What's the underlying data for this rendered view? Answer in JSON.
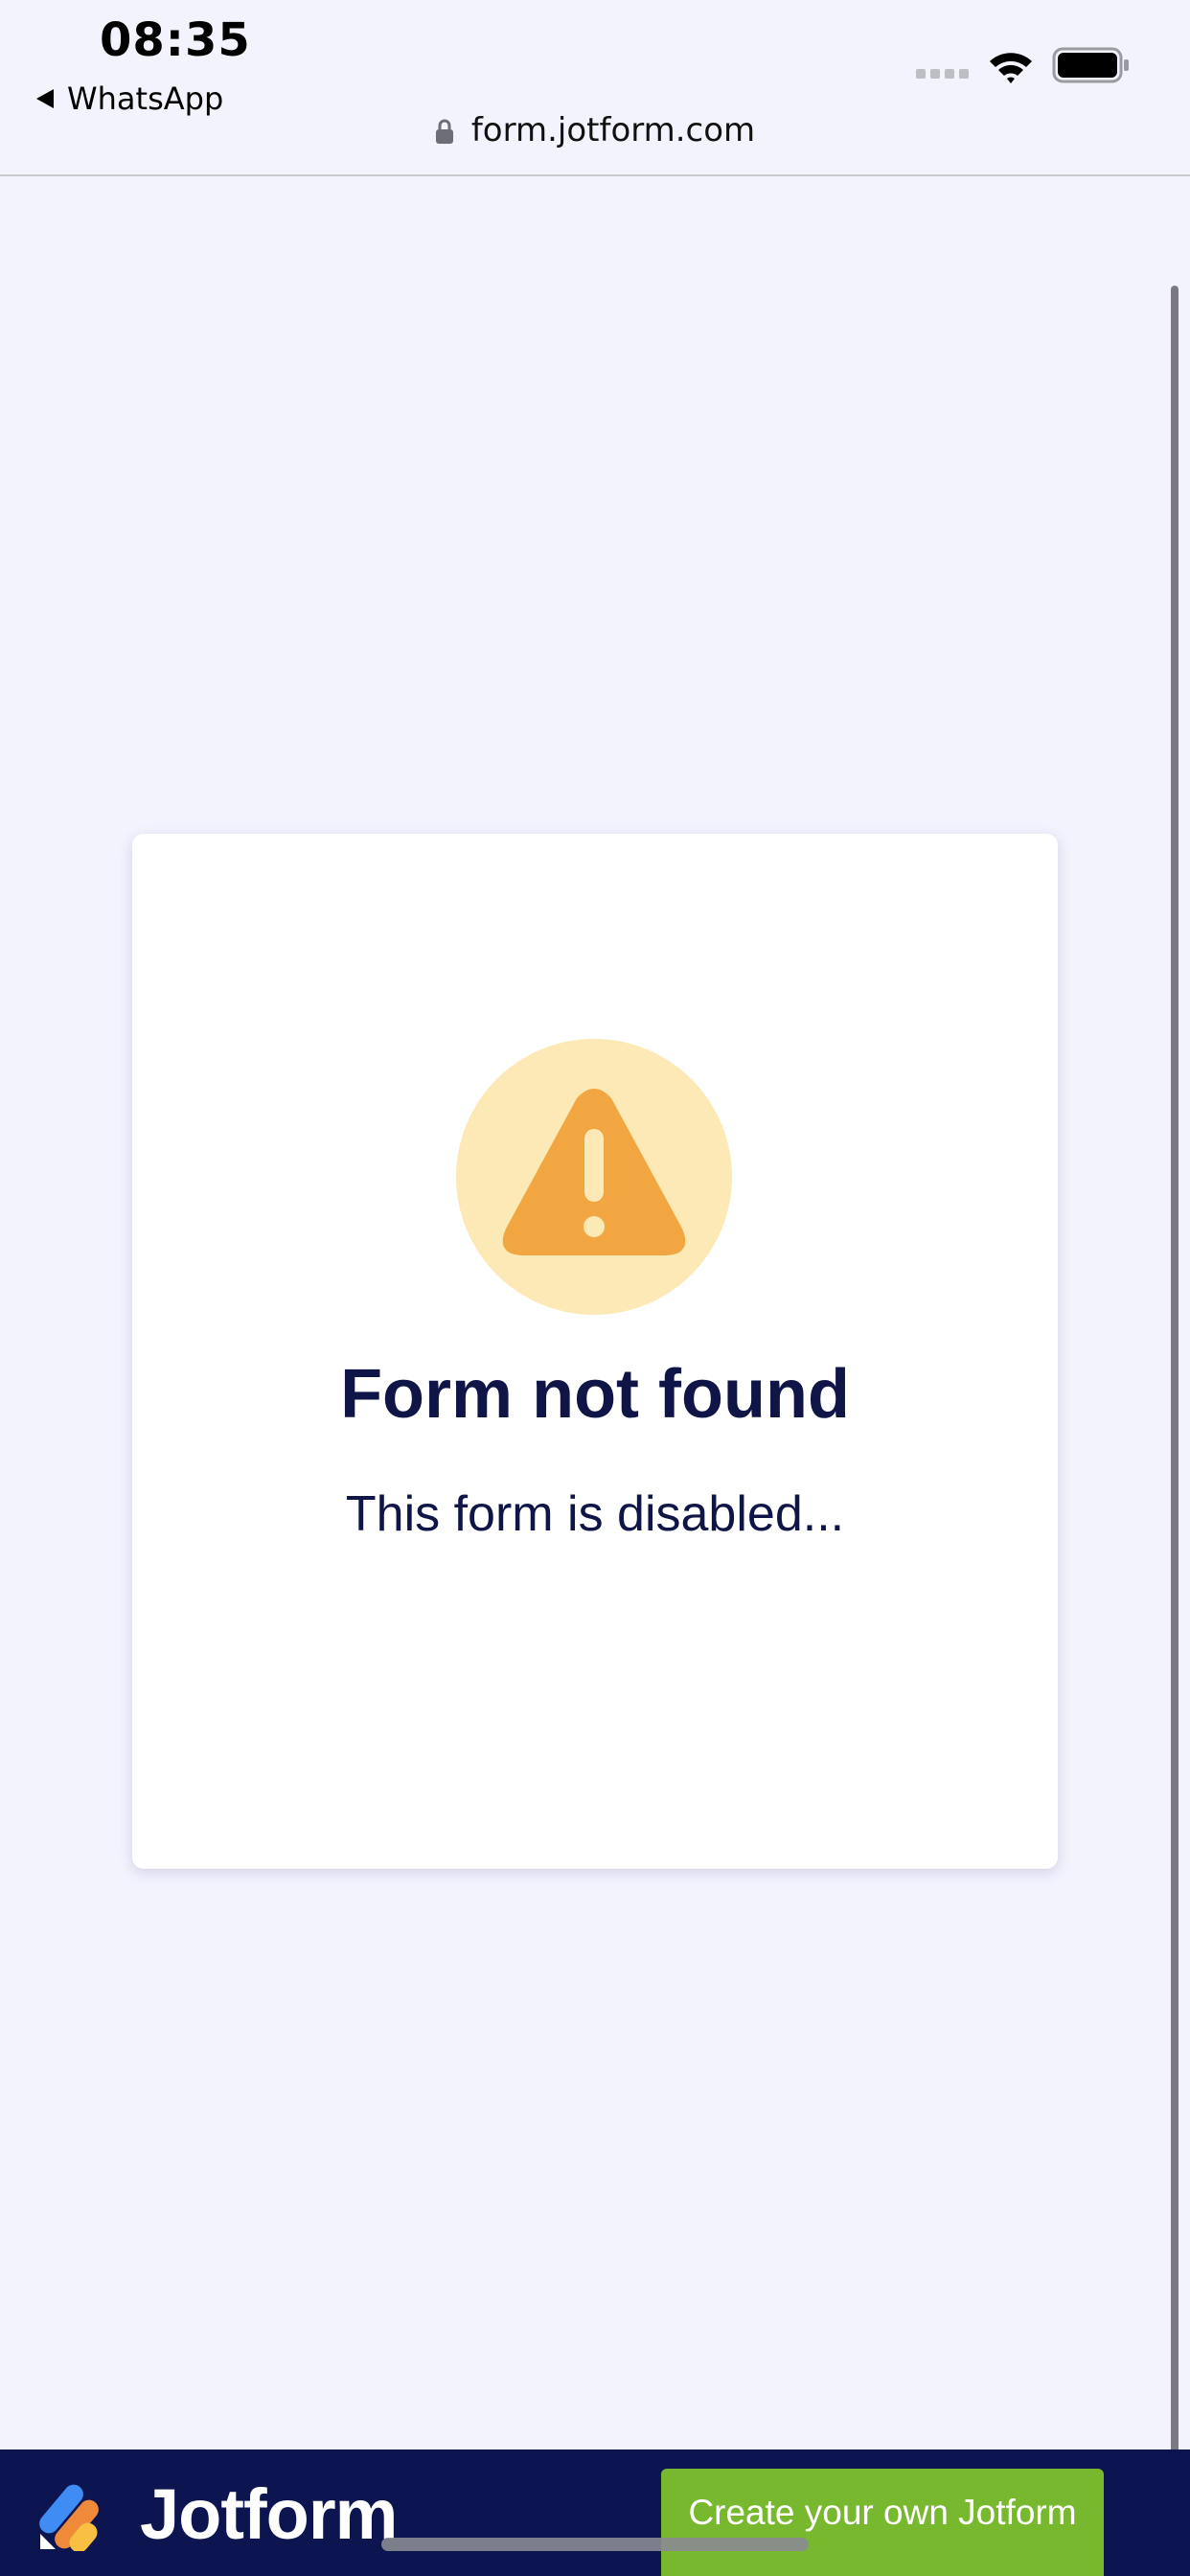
{
  "status_bar": {
    "time": "08:35",
    "back_app": "WhatsApp",
    "url": "form.jotform.com"
  },
  "card": {
    "title": "Form not found",
    "message": "This form is disabled...",
    "icon": "warning-triangle-icon"
  },
  "banner": {
    "brand": "Jotform",
    "cta_label": "Create your own Jotform"
  },
  "colors": {
    "page_bg": "#f3f3fe",
    "title_text": "#0f1546",
    "warning_orange": "#f2a641",
    "warning_circle": "#fce9b6",
    "banner_bg": "#0c1550",
    "cta_green": "#78b82f"
  }
}
